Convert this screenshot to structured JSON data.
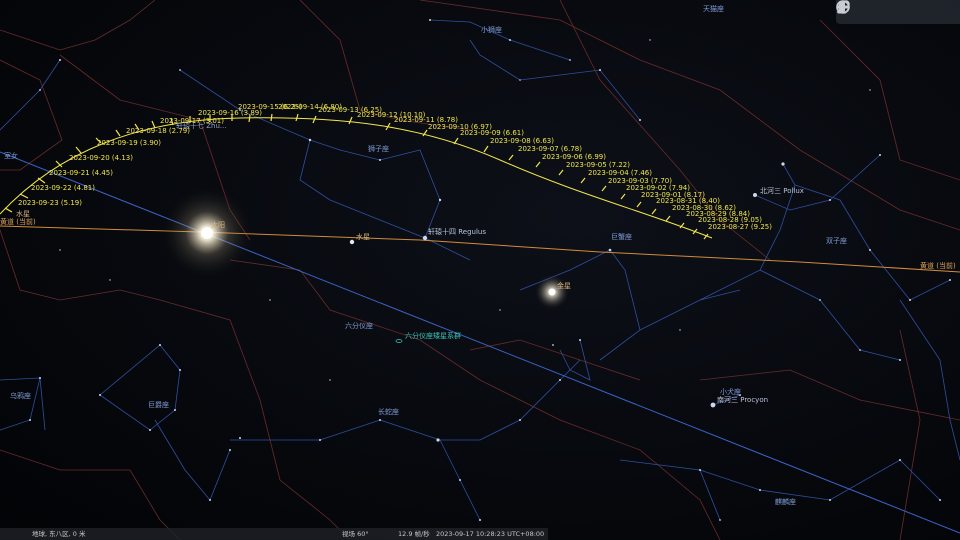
{
  "constellations": {
    "tianmao": "天猫座",
    "xiaoshi": "小狮座",
    "shizi": "狮子座",
    "juxie": "巨蟹座",
    "shuangzi": "双子座",
    "xiaoquan": "小犬座",
    "qilin": "麒麟座",
    "changshe": "长蛇座",
    "jujue": "巨爵座",
    "wuya": "乌鸦座",
    "liuxian": "六分仪座",
    "shinv": "室女"
  },
  "stars": {
    "regulus": "轩辕十四 Regulus",
    "pollux": "北河三 Pollux",
    "procyon": "南河三 Procyon",
    "xuanyuan": "轩辕十七 Zhu..."
  },
  "planets": {
    "sun": "太阳",
    "mercury": "水星",
    "venus": "金星"
  },
  "ecliptic": {
    "left": "黄道 (当前)",
    "right": "黄道 (当前)"
  },
  "dso": {
    "sextans": "六分仪座矮星系群"
  },
  "track_labels": [
    "2023-09-23 (5.19)",
    "2023-09-22 (4.81)",
    "2023-09-21 (4.45)",
    "2023-09-20 (4.13)",
    "2023-09-19 (3.90)",
    "2023-09-18 (2.79)",
    "2023-09-17 (3.01)",
    "2023-09-16 (3.89)",
    "2023-09-15 (6.25)",
    "2023-09-14 (6.80)",
    "2023-09-13 (6.25)",
    "2023-09-12 (10.10)",
    "2023-09-11 (8.78)",
    "2023-09-10 (6.97)",
    "2023-09-09 (6.61)",
    "2023-09-08 (6.63)",
    "2023-09-07 (6.78)",
    "2023-09-06 (6.99)",
    "2023-09-05 (7.22)",
    "2023-09-04 (7.46)",
    "2023-09-03 (7.70)",
    "2023-09-02 (7.94)",
    "2023-09-01 (8.17)",
    "2023-08-31 (8.40)",
    "2023-08-30 (8.62)",
    "2023-08-29 (8.84)",
    "2023-08-28 (9.05)",
    "2023-08-27 (9.25)"
  ],
  "status": {
    "location": "地球, 东八区, 0 米",
    "fov": "视场 60°",
    "fps": "12.9 帧/秒",
    "datetime": "2023-09-17 10:28:23 UTC+08:00"
  },
  "colors": {
    "constellation_lines": "#2f4fa0",
    "boundaries": "#6a2a2a",
    "ecliptic": "#d28b3a",
    "equator": "#3b63c8",
    "track": "#f2e64a"
  }
}
